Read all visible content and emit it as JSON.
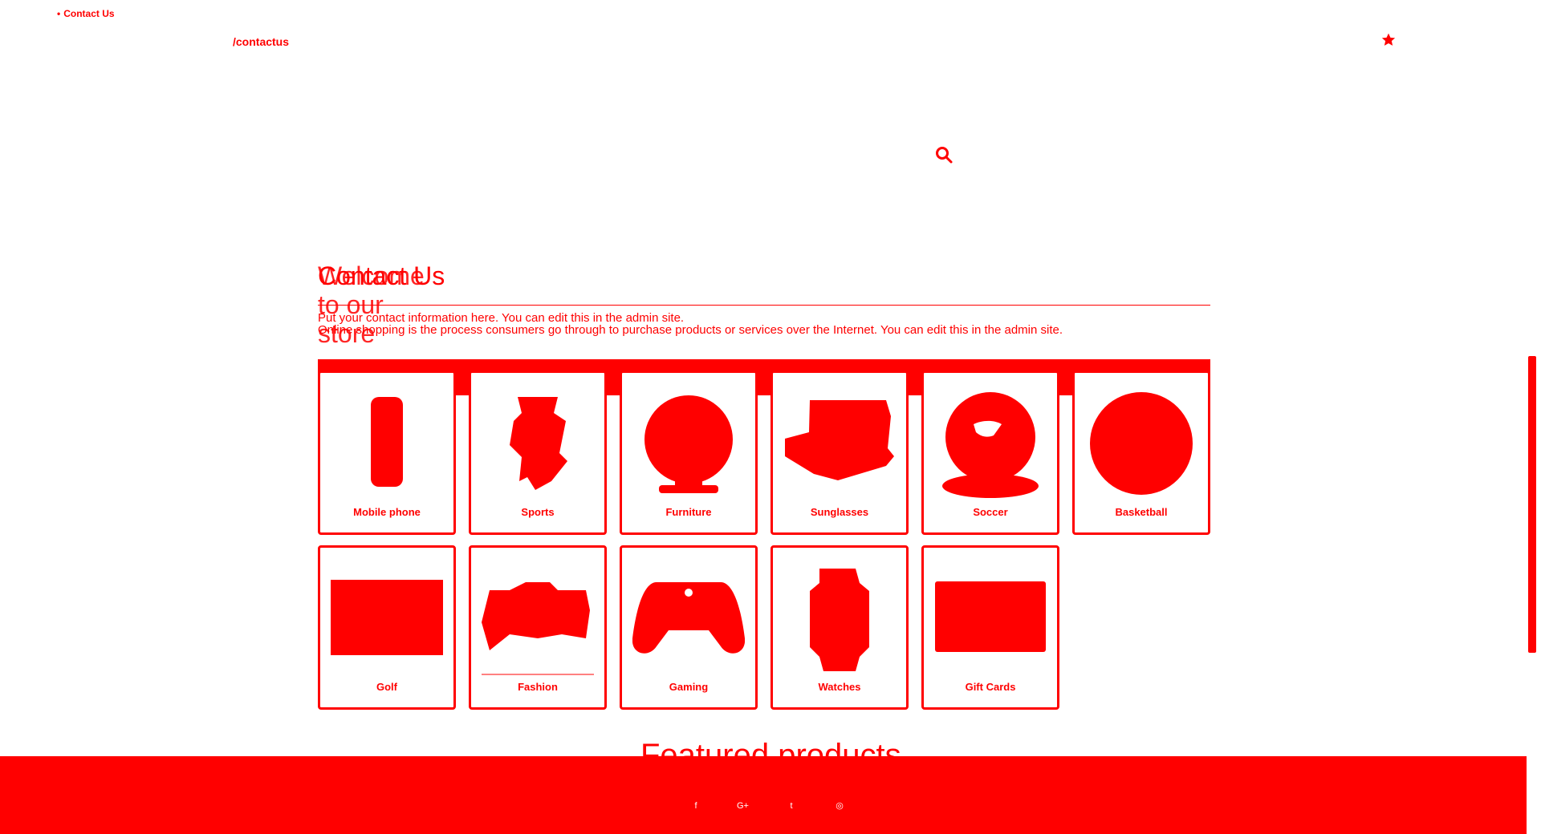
{
  "top_link": {
    "label": "Contact Us"
  },
  "url_text": "/contactus",
  "heading": {
    "primary": "Contact Us",
    "secondary": "Welcome to our store"
  },
  "body_text": {
    "line1": "Put your contact information here. You can edit this in the admin site.",
    "line2": "Online shopping is the process consumers go through to purchase products or services over the Internet. You can edit this in the admin site."
  },
  "categories": [
    {
      "label": "Mobile phone",
      "icon": "mobile-phone"
    },
    {
      "label": "Sports",
      "icon": "sports"
    },
    {
      "label": "Furniture",
      "icon": "furniture"
    },
    {
      "label": "Sunglasses",
      "icon": "sunglasses"
    },
    {
      "label": "Soccer",
      "icon": "soccer"
    },
    {
      "label": "Basketball",
      "icon": "basketball"
    },
    {
      "label": "Golf",
      "icon": "golf"
    },
    {
      "label": "Fashion",
      "icon": "fashion"
    },
    {
      "label": "Gaming",
      "icon": "gaming"
    },
    {
      "label": "Watches",
      "icon": "watches"
    },
    {
      "label": "Gift Cards",
      "icon": "gift-cards"
    }
  ],
  "featured": {
    "title": "Featured products"
  },
  "footer": {
    "social": [
      "facebook-icon",
      "google-plus-icon",
      "twitter-icon",
      "rss-icon"
    ]
  },
  "theme": {
    "accent": "#ff0000",
    "background": "#ffffff"
  }
}
